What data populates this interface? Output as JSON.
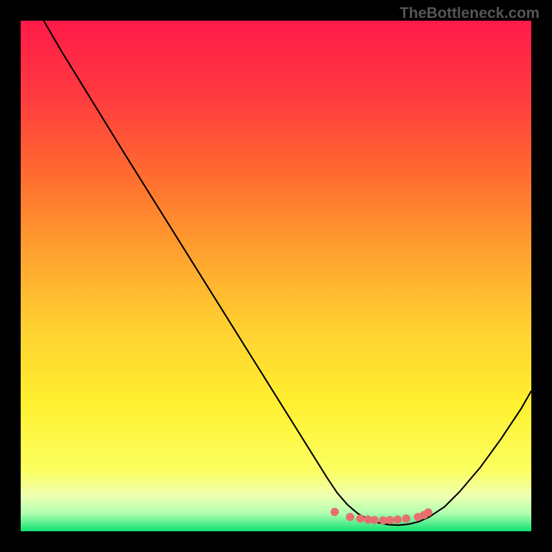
{
  "attribution": "TheBottleneck.com",
  "chart_data": {
    "type": "line",
    "title": "",
    "xlabel": "",
    "ylabel": "",
    "xlim": [
      0,
      100
    ],
    "ylim": [
      0,
      100
    ],
    "gradient_stops": [
      {
        "offset": 0,
        "color": "#ff1a4a"
      },
      {
        "offset": 15,
        "color": "#ff3b3f"
      },
      {
        "offset": 30,
        "color": "#ff6b2f"
      },
      {
        "offset": 45,
        "color": "#ffa02f"
      },
      {
        "offset": 60,
        "color": "#ffd030"
      },
      {
        "offset": 75,
        "color": "#fff030"
      },
      {
        "offset": 88,
        "color": "#fcff60"
      },
      {
        "offset": 93,
        "color": "#f0ffb0"
      },
      {
        "offset": 96.5,
        "color": "#b0ffb0"
      },
      {
        "offset": 100,
        "color": "#10e070"
      }
    ],
    "series": [
      {
        "name": "bottleneck-curve",
        "color": "#000000",
        "x": [
          4.5,
          8,
          12,
          16,
          20,
          25,
          30,
          35,
          40,
          45,
          50,
          55,
          60,
          62,
          64,
          66,
          68,
          70,
          72,
          74,
          76,
          78,
          80,
          83,
          86,
          90,
          94,
          98,
          100
        ],
        "y": [
          100,
          94,
          87.5,
          81,
          74.5,
          66.5,
          58.5,
          50.5,
          42.5,
          34.5,
          26.5,
          18.5,
          10.5,
          7.5,
          5.2,
          3.5,
          2.4,
          1.7,
          1.3,
          1.2,
          1.4,
          1.9,
          2.8,
          4.8,
          7.8,
          12.5,
          18,
          24,
          27.5
        ]
      }
    ],
    "scatter_points": {
      "name": "optimal-zone-markers",
      "color": "#e67070",
      "x": [
        61.5,
        64.5,
        66.5,
        68,
        69.3,
        71,
        72.3,
        73.8,
        75.5,
        77.8,
        79,
        79.8
      ],
      "y": [
        3.8,
        2.8,
        2.5,
        2.3,
        2.2,
        2.15,
        2.2,
        2.3,
        2.5,
        2.8,
        3.2,
        3.7
      ]
    }
  }
}
